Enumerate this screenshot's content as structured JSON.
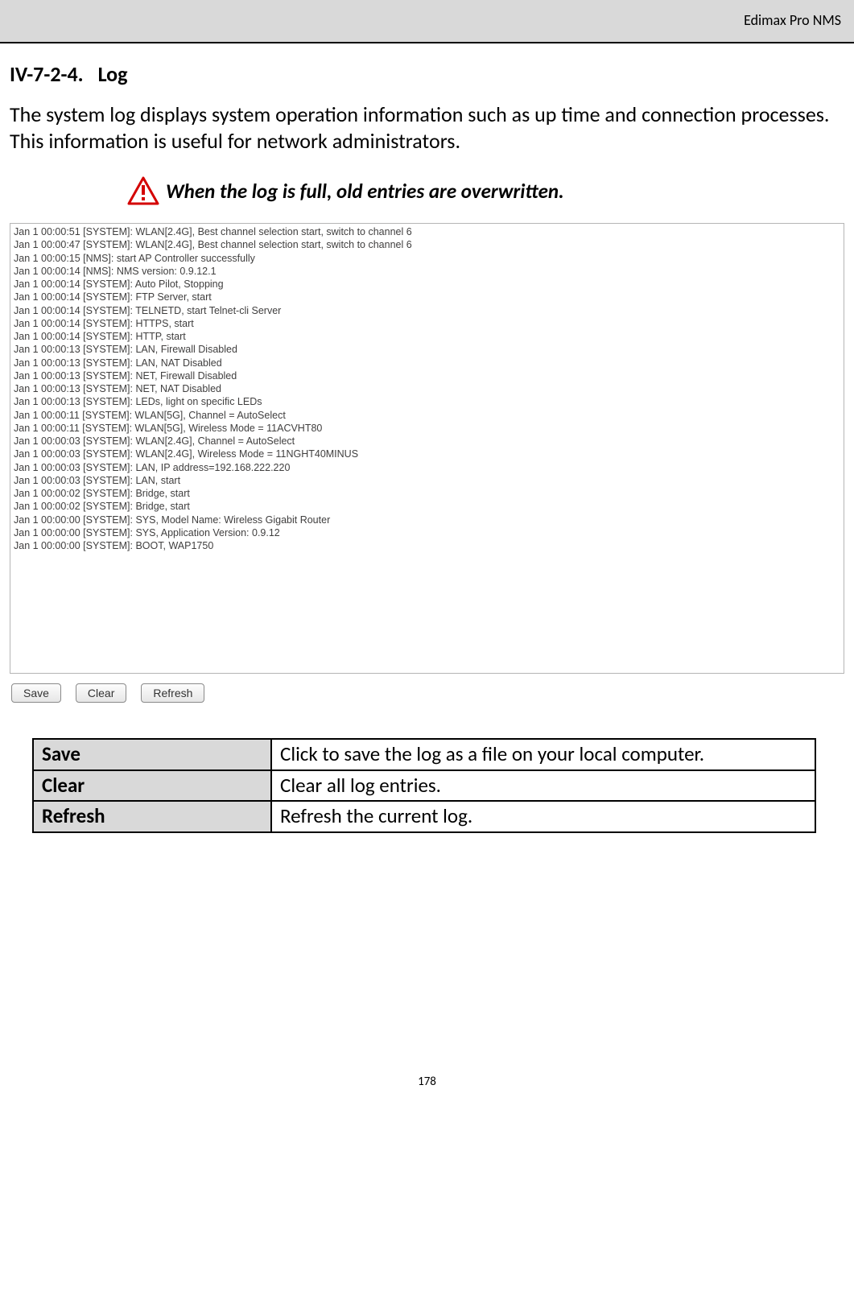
{
  "header": {
    "product": "Edimax Pro NMS"
  },
  "section": {
    "number": "IV-7-2-4.",
    "title": "Log"
  },
  "description": "The system log displays system operation information such as up time and connection processes. This information is useful for network administrators.",
  "note": "When the log is full, old entries are overwritten.",
  "log_lines": [
    "Jan  1 00:00:51 [SYSTEM]: WLAN[2.4G], Best channel selection start, switch to channel 6",
    "Jan  1 00:00:47 [SYSTEM]: WLAN[2.4G], Best channel selection start, switch to channel 6",
    "Jan  1 00:00:15 [NMS]: start AP Controller successfully",
    "Jan  1 00:00:14 [NMS]: NMS version: 0.9.12.1",
    "Jan  1 00:00:14 [SYSTEM]: Auto Pilot, Stopping",
    "Jan  1 00:00:14 [SYSTEM]: FTP Server, start",
    "Jan  1 00:00:14 [SYSTEM]: TELNETD, start Telnet-cli Server",
    "Jan  1 00:00:14 [SYSTEM]: HTTPS, start",
    "Jan  1 00:00:14 [SYSTEM]: HTTP, start",
    "Jan  1 00:00:13 [SYSTEM]: LAN, Firewall Disabled",
    "Jan  1 00:00:13 [SYSTEM]: LAN, NAT Disabled",
    "Jan  1 00:00:13 [SYSTEM]: NET, Firewall Disabled",
    "Jan  1 00:00:13 [SYSTEM]: NET, NAT Disabled",
    "Jan  1 00:00:13 [SYSTEM]: LEDs, light on specific LEDs",
    "Jan  1 00:00:11 [SYSTEM]: WLAN[5G], Channel = AutoSelect",
    "Jan  1 00:00:11 [SYSTEM]: WLAN[5G], Wireless Mode = 11ACVHT80",
    "Jan  1 00:00:03 [SYSTEM]: WLAN[2.4G], Channel = AutoSelect",
    "Jan  1 00:00:03 [SYSTEM]: WLAN[2.4G], Wireless Mode = 11NGHT40MINUS",
    "Jan  1 00:00:03 [SYSTEM]: LAN, IP address=192.168.222.220",
    "Jan  1 00:00:03 [SYSTEM]: LAN, start",
    "Jan  1 00:00:02 [SYSTEM]: Bridge, start",
    "Jan  1 00:00:02 [SYSTEM]: Bridge, start",
    "Jan  1 00:00:00 [SYSTEM]: SYS, Model Name: Wireless Gigabit Router",
    "Jan  1 00:00:00 [SYSTEM]: SYS, Application Version: 0.9.12",
    "Jan  1 00:00:00 [SYSTEM]: BOOT, WAP1750"
  ],
  "buttons": {
    "save": "Save",
    "clear": "Clear",
    "refresh": "Refresh"
  },
  "table": {
    "rows": [
      {
        "key": "Save",
        "val": "Click to save the log as a file on your local computer."
      },
      {
        "key": "Clear",
        "val": "Clear all log entries."
      },
      {
        "key": "Refresh",
        "val": "Refresh the current log."
      }
    ]
  },
  "page_number": "178"
}
